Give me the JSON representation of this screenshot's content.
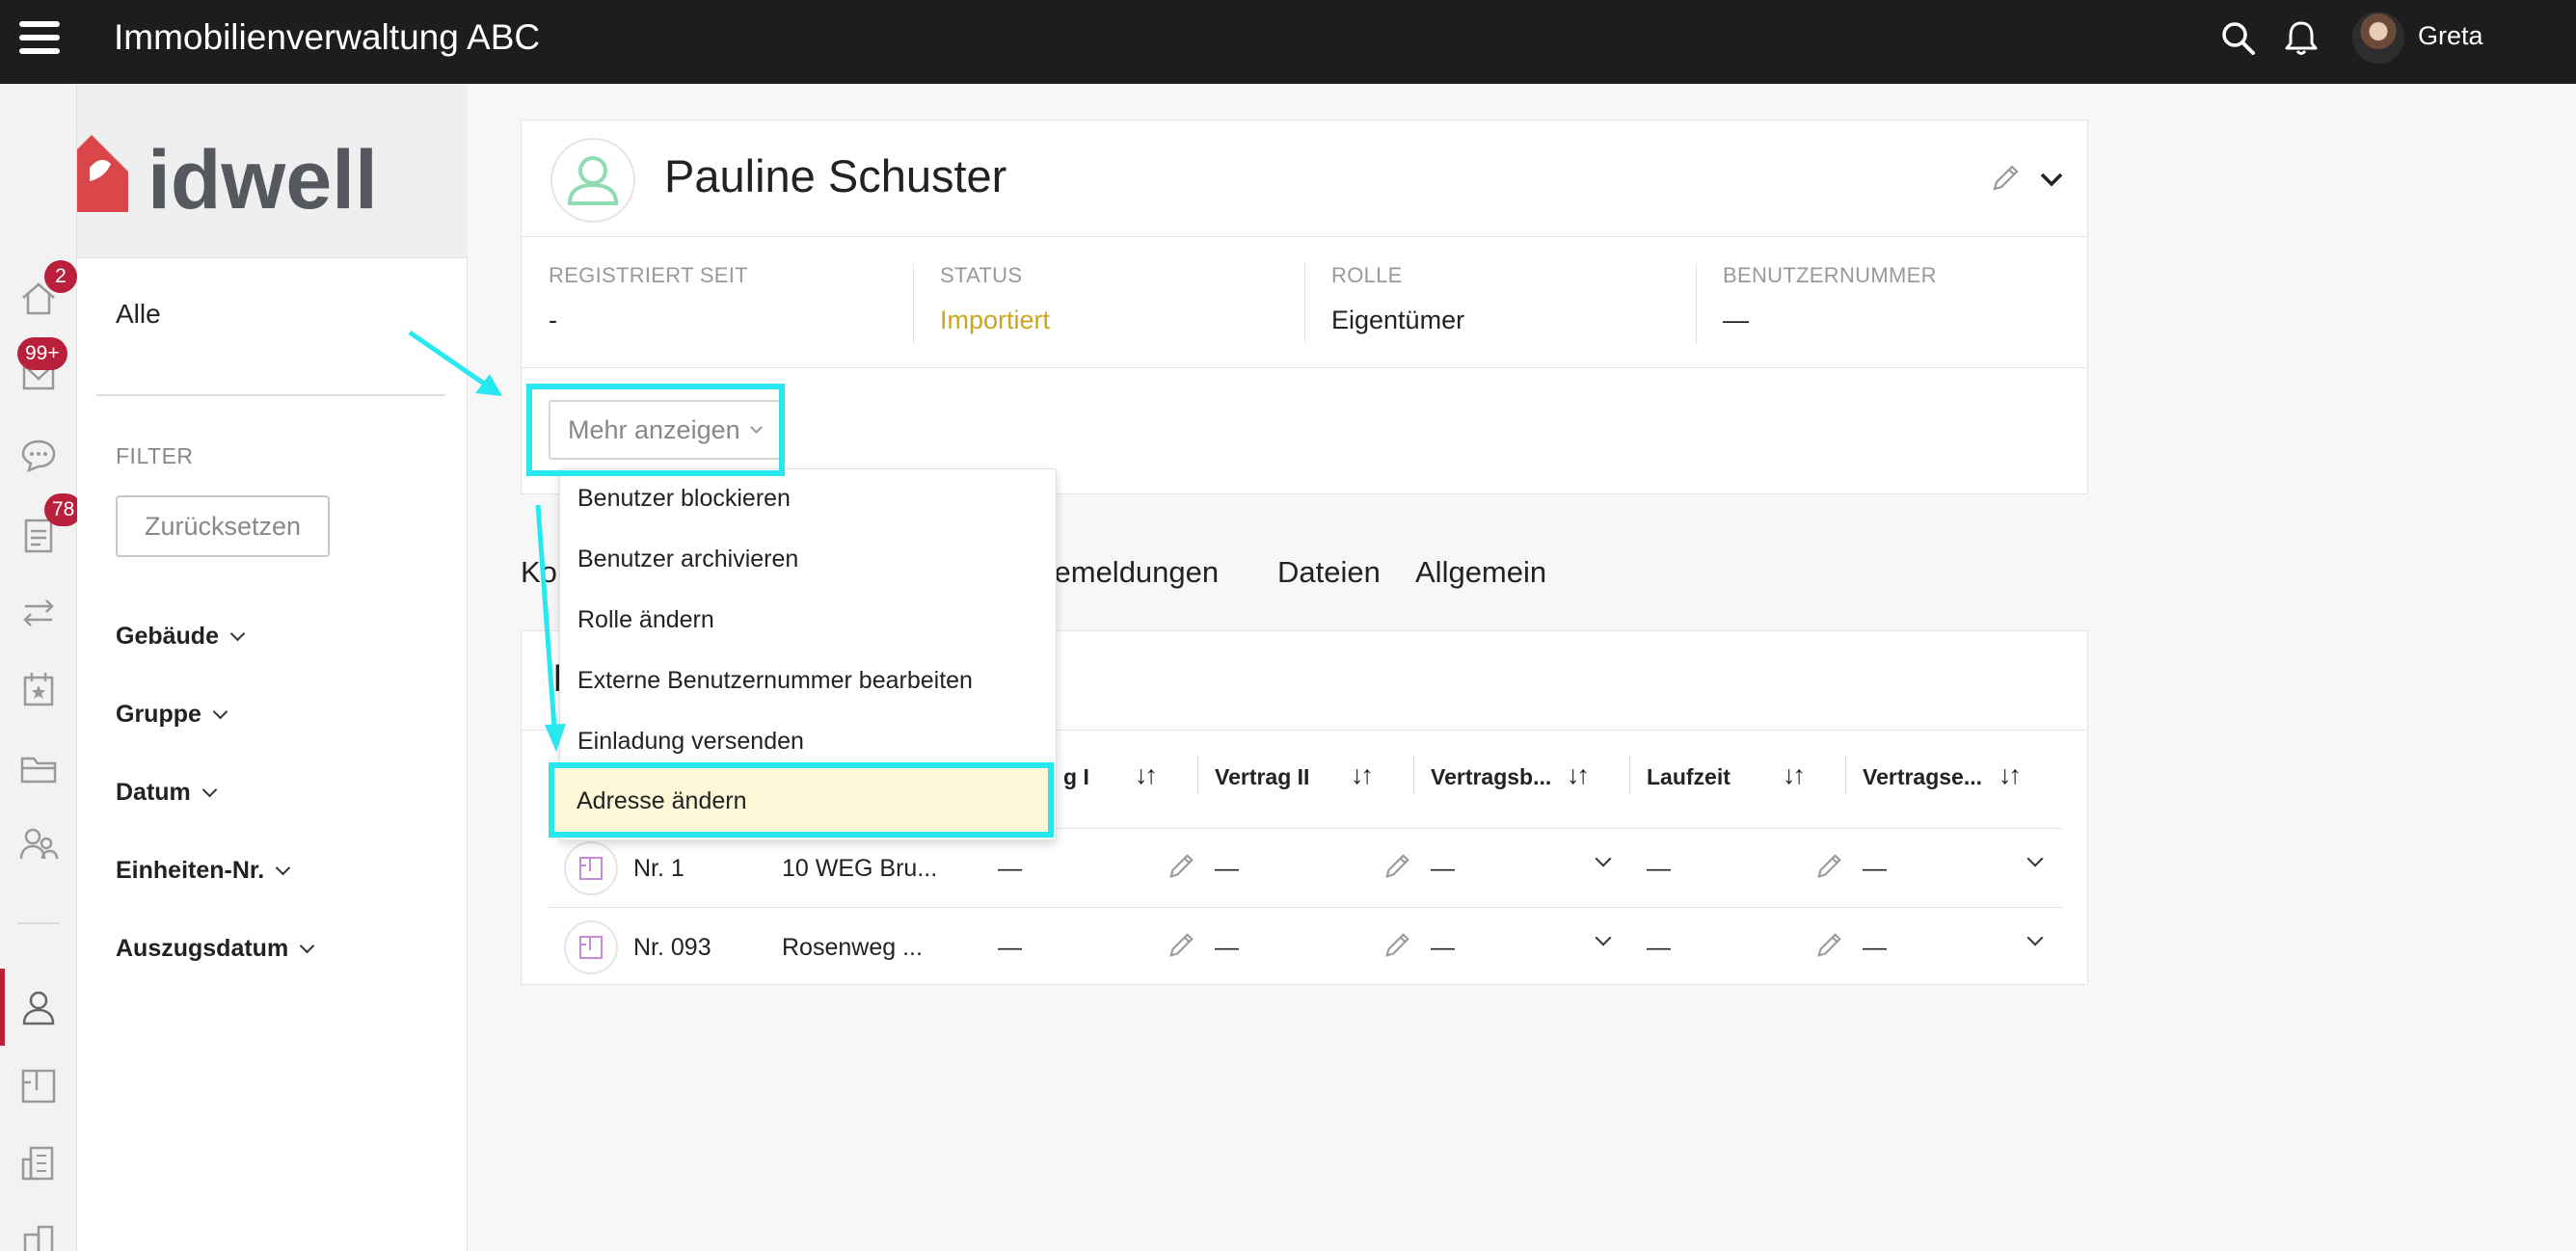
{
  "header": {
    "app_title": "Immobilienverwaltung ABC",
    "user_name": "Greta"
  },
  "logo": {
    "text": "idwell",
    "color": "#d9474b"
  },
  "rail": {
    "badges": {
      "home": "2",
      "inbox": "99+",
      "documents": "78"
    }
  },
  "filter": {
    "all_label": "Alle",
    "filter_label": "FILTER",
    "reset_label": "Zurücksetzen",
    "facets": [
      "Gebäude",
      "Gruppe",
      "Datum",
      "Einheiten-Nr.",
      "Auszugsdatum"
    ]
  },
  "profile": {
    "name": "Pauline Schuster",
    "meta": [
      {
        "label": "REGISTRIERT SEIT",
        "value": "-"
      },
      {
        "label": "STATUS",
        "value": "Importiert"
      },
      {
        "label": "ROLLE",
        "value": "Eigentümer"
      },
      {
        "label": "BENUTZERNUMMER",
        "value": "—"
      }
    ],
    "more_label": "Mehr anzeigen",
    "status_color": "#c9a624"
  },
  "dropdown": {
    "items": [
      "Benutzer blockieren",
      "Benutzer archivieren",
      "Rolle ändern",
      "Externe Benutzernummer bearbeiten",
      "Einladung versenden",
      "Adresse ändern"
    ]
  },
  "tabs": {
    "partial_first": "Ko",
    "partial_second": "cemeldungen",
    "files": "Dateien",
    "general": "Allgemein"
  },
  "table": {
    "partial_icon": "[",
    "headers": [
      "g I",
      "Vertrag II",
      "Vertragsb...",
      "Laufzeit",
      "Vertragse..."
    ],
    "sort_glyph": "↓↑",
    "rows": [
      {
        "unit": "Nr. 1",
        "address": "10 WEG Bru...",
        "c1": "—",
        "c2": "—",
        "c3": "—",
        "c4": "—",
        "c5": "—"
      },
      {
        "unit": "Nr. 093",
        "address": "Rosenweg ...",
        "c1": "—",
        "c2": "—",
        "c3": "—",
        "c4": "—",
        "c5": "—"
      }
    ]
  },
  "colors": {
    "accent": "#b8203c",
    "annotation": "#26e8ee",
    "topbar": "#1d1d1d"
  }
}
